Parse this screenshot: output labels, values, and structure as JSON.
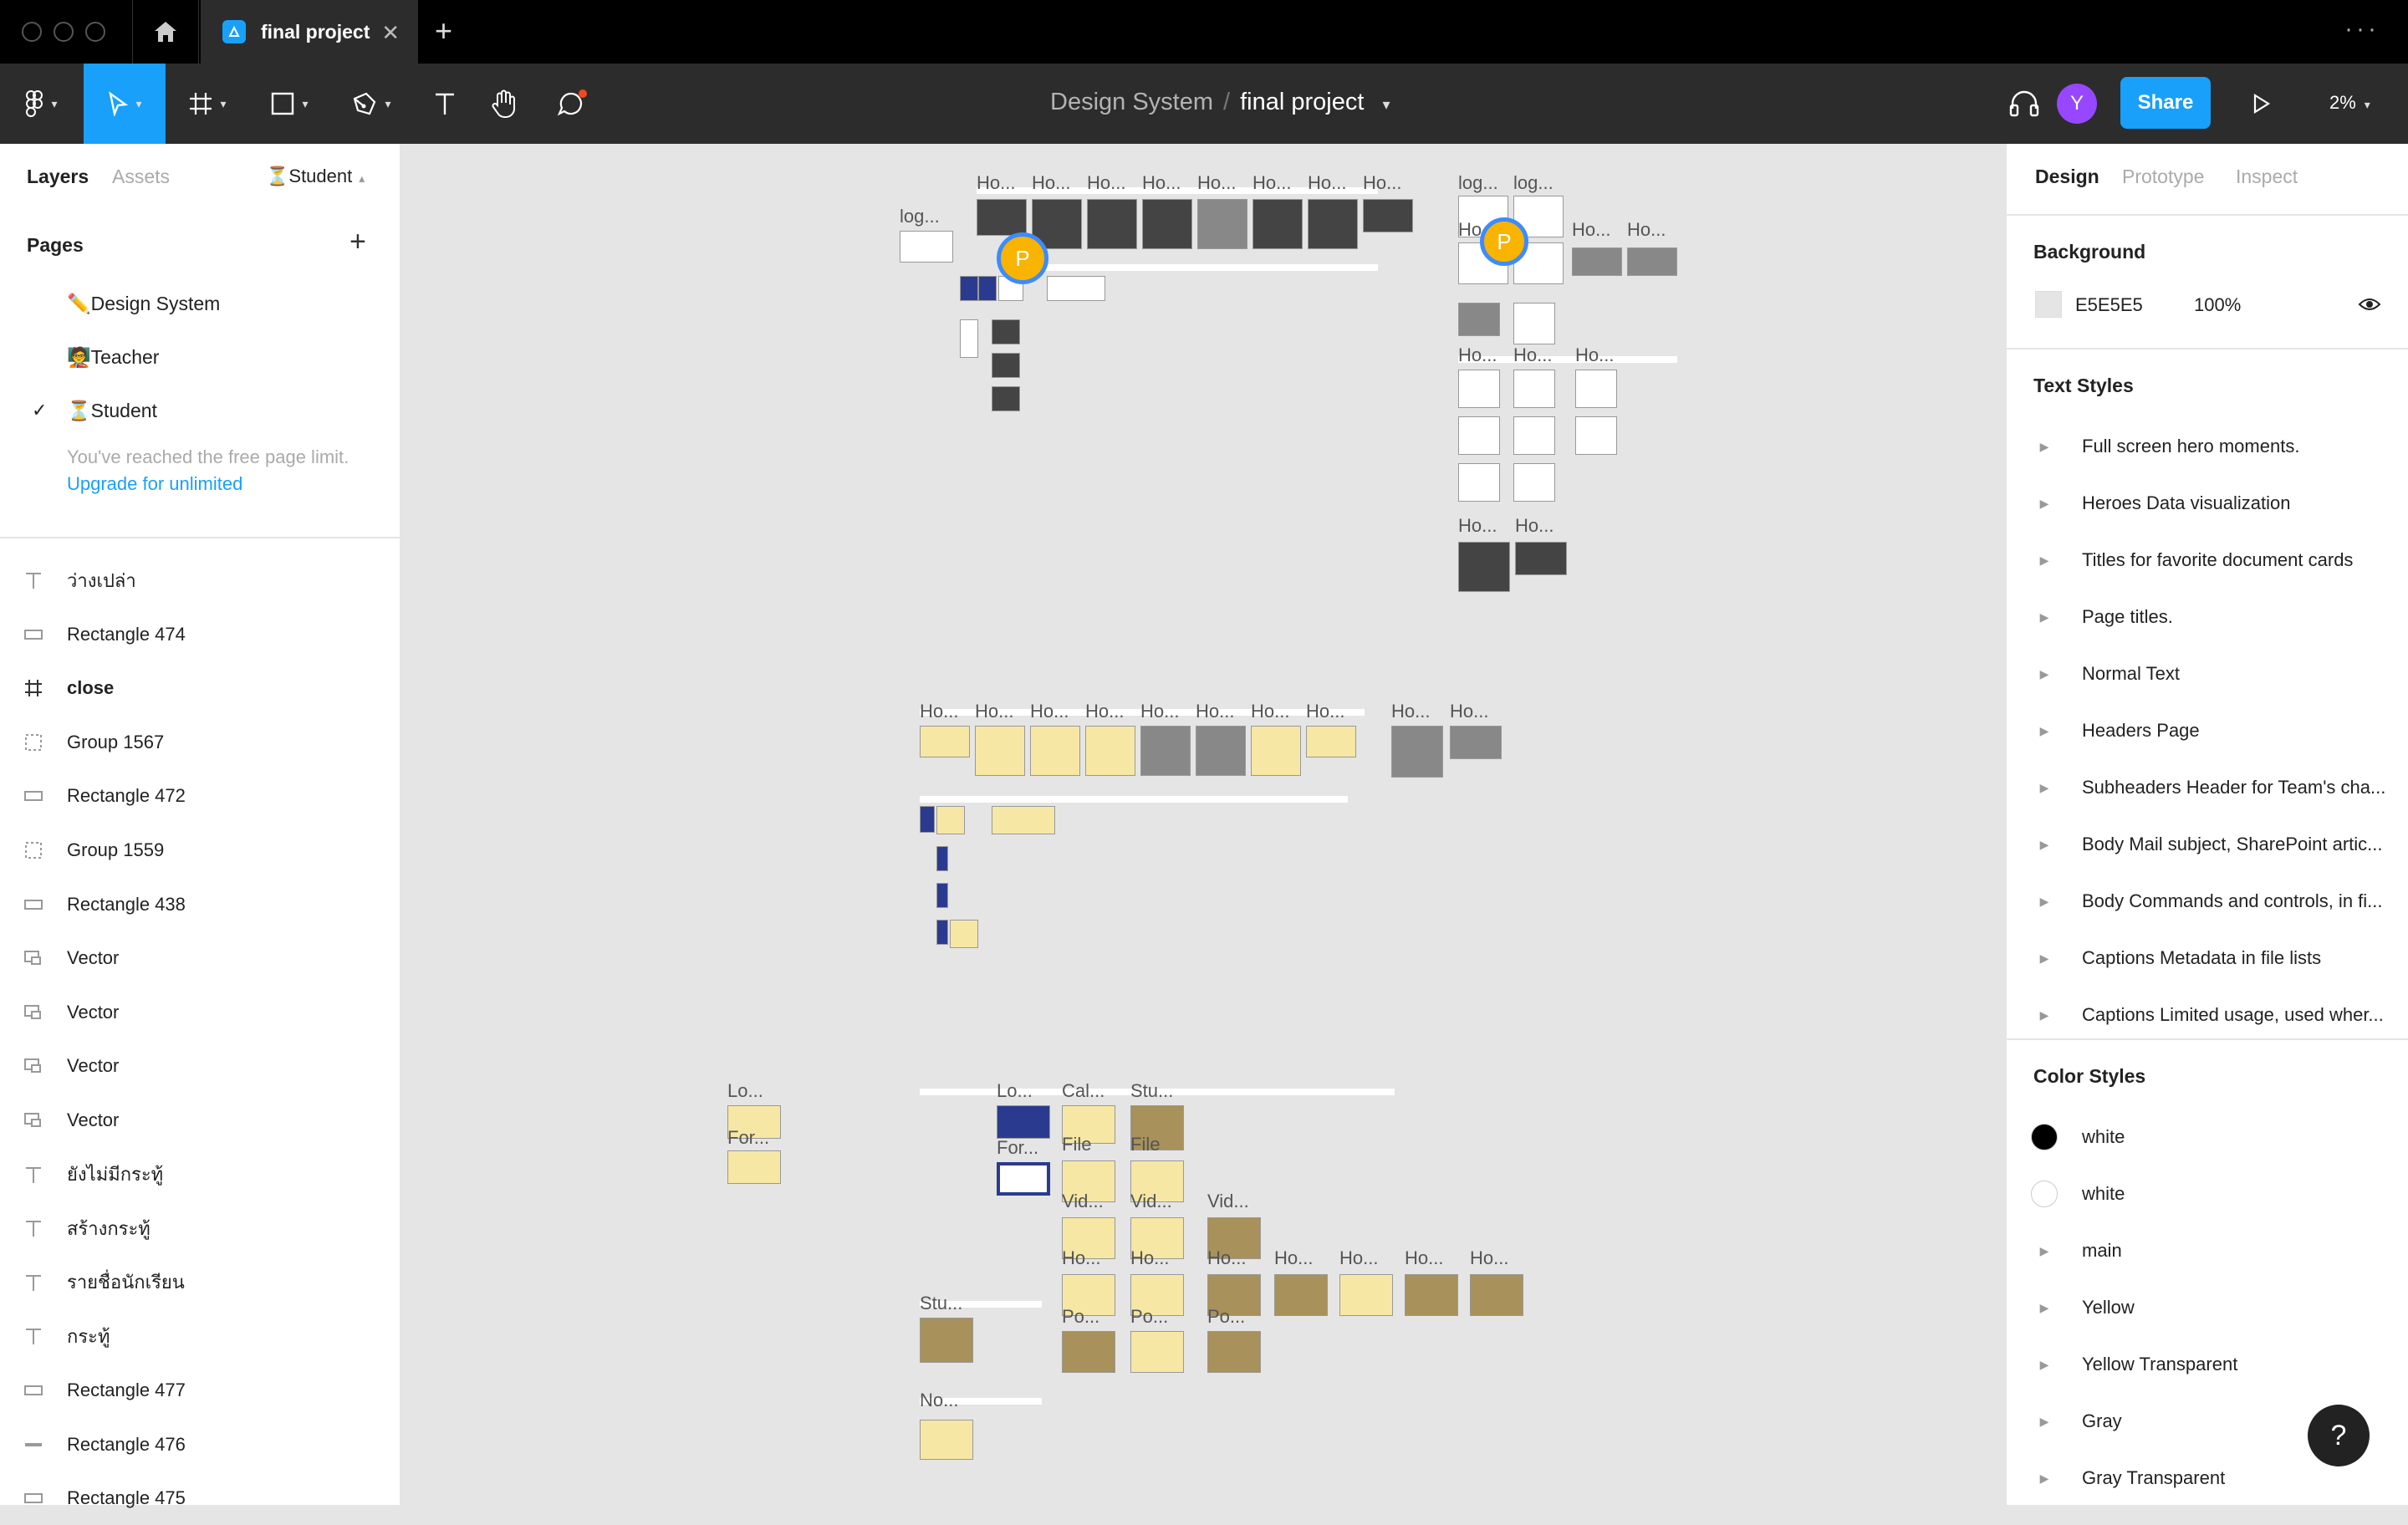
{
  "tabs": {
    "file_tab_label": "final project"
  },
  "toolbar": {
    "breadcrumb_project": "Design System",
    "breadcrumb_separator": "/",
    "breadcrumb_file": "final project",
    "avatar_initial": "Y",
    "share_label": "Share",
    "zoom_level": "2%"
  },
  "left_panel": {
    "tab_layers": "Layers",
    "tab_assets": "Assets",
    "current_page_badge": "⏳Student",
    "pages_title": "Pages",
    "pages": [
      {
        "label": "✏️Design System",
        "selected": false
      },
      {
        "label": "🧑‍🏫Teacher",
        "selected": false
      },
      {
        "label": "⏳Student",
        "selected": true
      }
    ],
    "limit_text": "You've reached the free page limit.",
    "upgrade_link": "Upgrade for unlimited",
    "layers": [
      {
        "icon": "text-icon",
        "label": "ว่างเปล่า"
      },
      {
        "icon": "rectangle-icon",
        "label": "Rectangle 474"
      },
      {
        "icon": "frame-icon",
        "label": "close"
      },
      {
        "icon": "group-icon",
        "label": "Group 1567"
      },
      {
        "icon": "rectangle-icon",
        "label": "Rectangle 472"
      },
      {
        "icon": "group-icon",
        "label": "Group 1559"
      },
      {
        "icon": "rectangle-icon",
        "label": "Rectangle 438"
      },
      {
        "icon": "vector-icon",
        "label": "Vector"
      },
      {
        "icon": "vector-icon",
        "label": "Vector"
      },
      {
        "icon": "vector-icon",
        "label": "Vector"
      },
      {
        "icon": "vector-icon",
        "label": "Vector"
      },
      {
        "icon": "text-icon",
        "label": "ยังไม่มีกระทู้"
      },
      {
        "icon": "text-icon",
        "label": "สร้างกระทู้"
      },
      {
        "icon": "text-icon",
        "label": "รายชื่อนักเรียน"
      },
      {
        "icon": "text-icon",
        "label": "กระทู้"
      },
      {
        "icon": "rectangle-icon",
        "label": "Rectangle 477"
      },
      {
        "icon": "line-icon",
        "label": "Rectangle 476"
      },
      {
        "icon": "rectangle-icon",
        "label": "Rectangle 475"
      }
    ]
  },
  "right_panel": {
    "tab_design": "Design",
    "tab_prototype": "Prototype",
    "tab_inspect": "Inspect",
    "background_title": "Background",
    "background_hex": "E5E5E5",
    "background_opacity": "100%",
    "background_color": "#E5E5E5",
    "text_styles_title": "Text Styles",
    "text_styles": [
      "Full screen hero moments.",
      "Heroes Data visualization",
      "Titles for favorite document cards",
      "Page titles.",
      "Normal Text",
      "Headers Page",
      "Subheaders Header for Team's cha...",
      "Body Mail subject, SharePoint artic...",
      "Body Commands and controls, in fi...",
      "Captions Metadata in file lists",
      "Captions Limited usage, used wher..."
    ],
    "color_styles_title": "Color Styles",
    "color_styles": [
      {
        "label": "white",
        "swatch": "#000000",
        "type": "swatch"
      },
      {
        "label": "white",
        "swatch": "#FFFFFF",
        "type": "swatch"
      },
      {
        "label": "main",
        "type": "group"
      },
      {
        "label": "Yellow",
        "type": "group"
      },
      {
        "label": "Yellow Transparent",
        "type": "group"
      },
      {
        "label": "Gray",
        "type": "group"
      },
      {
        "label": "Gray Transparent",
        "type": "group"
      }
    ],
    "help_label": "?"
  },
  "canvas": {
    "collaborator_initial": "P",
    "labels_row1": [
      "log...",
      "Ho...",
      "Ho...",
      "Ho...",
      "Ho...",
      "Ho...",
      "Ho...",
      "Ho...",
      "Ho..."
    ],
    "labels_right": [
      "log...",
      "log...",
      "Ho...",
      "Ho...",
      "Ho...",
      "Ho...",
      "Ho...",
      "Ho...",
      "Ho...",
      "Ho...",
      "Ho..."
    ],
    "labels_mid": [
      "Ho...",
      "Ho...",
      "Ho...",
      "Ho...",
      "Ho...",
      "Ho...",
      "Ho...",
      "Ho...",
      "Ho...",
      "Ho..."
    ],
    "labels_bottom": [
      "Lo...",
      "For...",
      "Lo...",
      "For...",
      "Cal...",
      "Stu...",
      "File",
      "File",
      "Vid...",
      "Vid...",
      "Vid...",
      "Ho...",
      "Ho...",
      "Ho...",
      "Ho...",
      "Ho...",
      "Ho...",
      "Ho...",
      "Stu...",
      "Po...",
      "Po...",
      "Po...",
      "No..."
    ],
    "brand_colors": {
      "accent": "#18A0FB",
      "collab": "#F8B400",
      "avatar": "#9747FF"
    }
  }
}
